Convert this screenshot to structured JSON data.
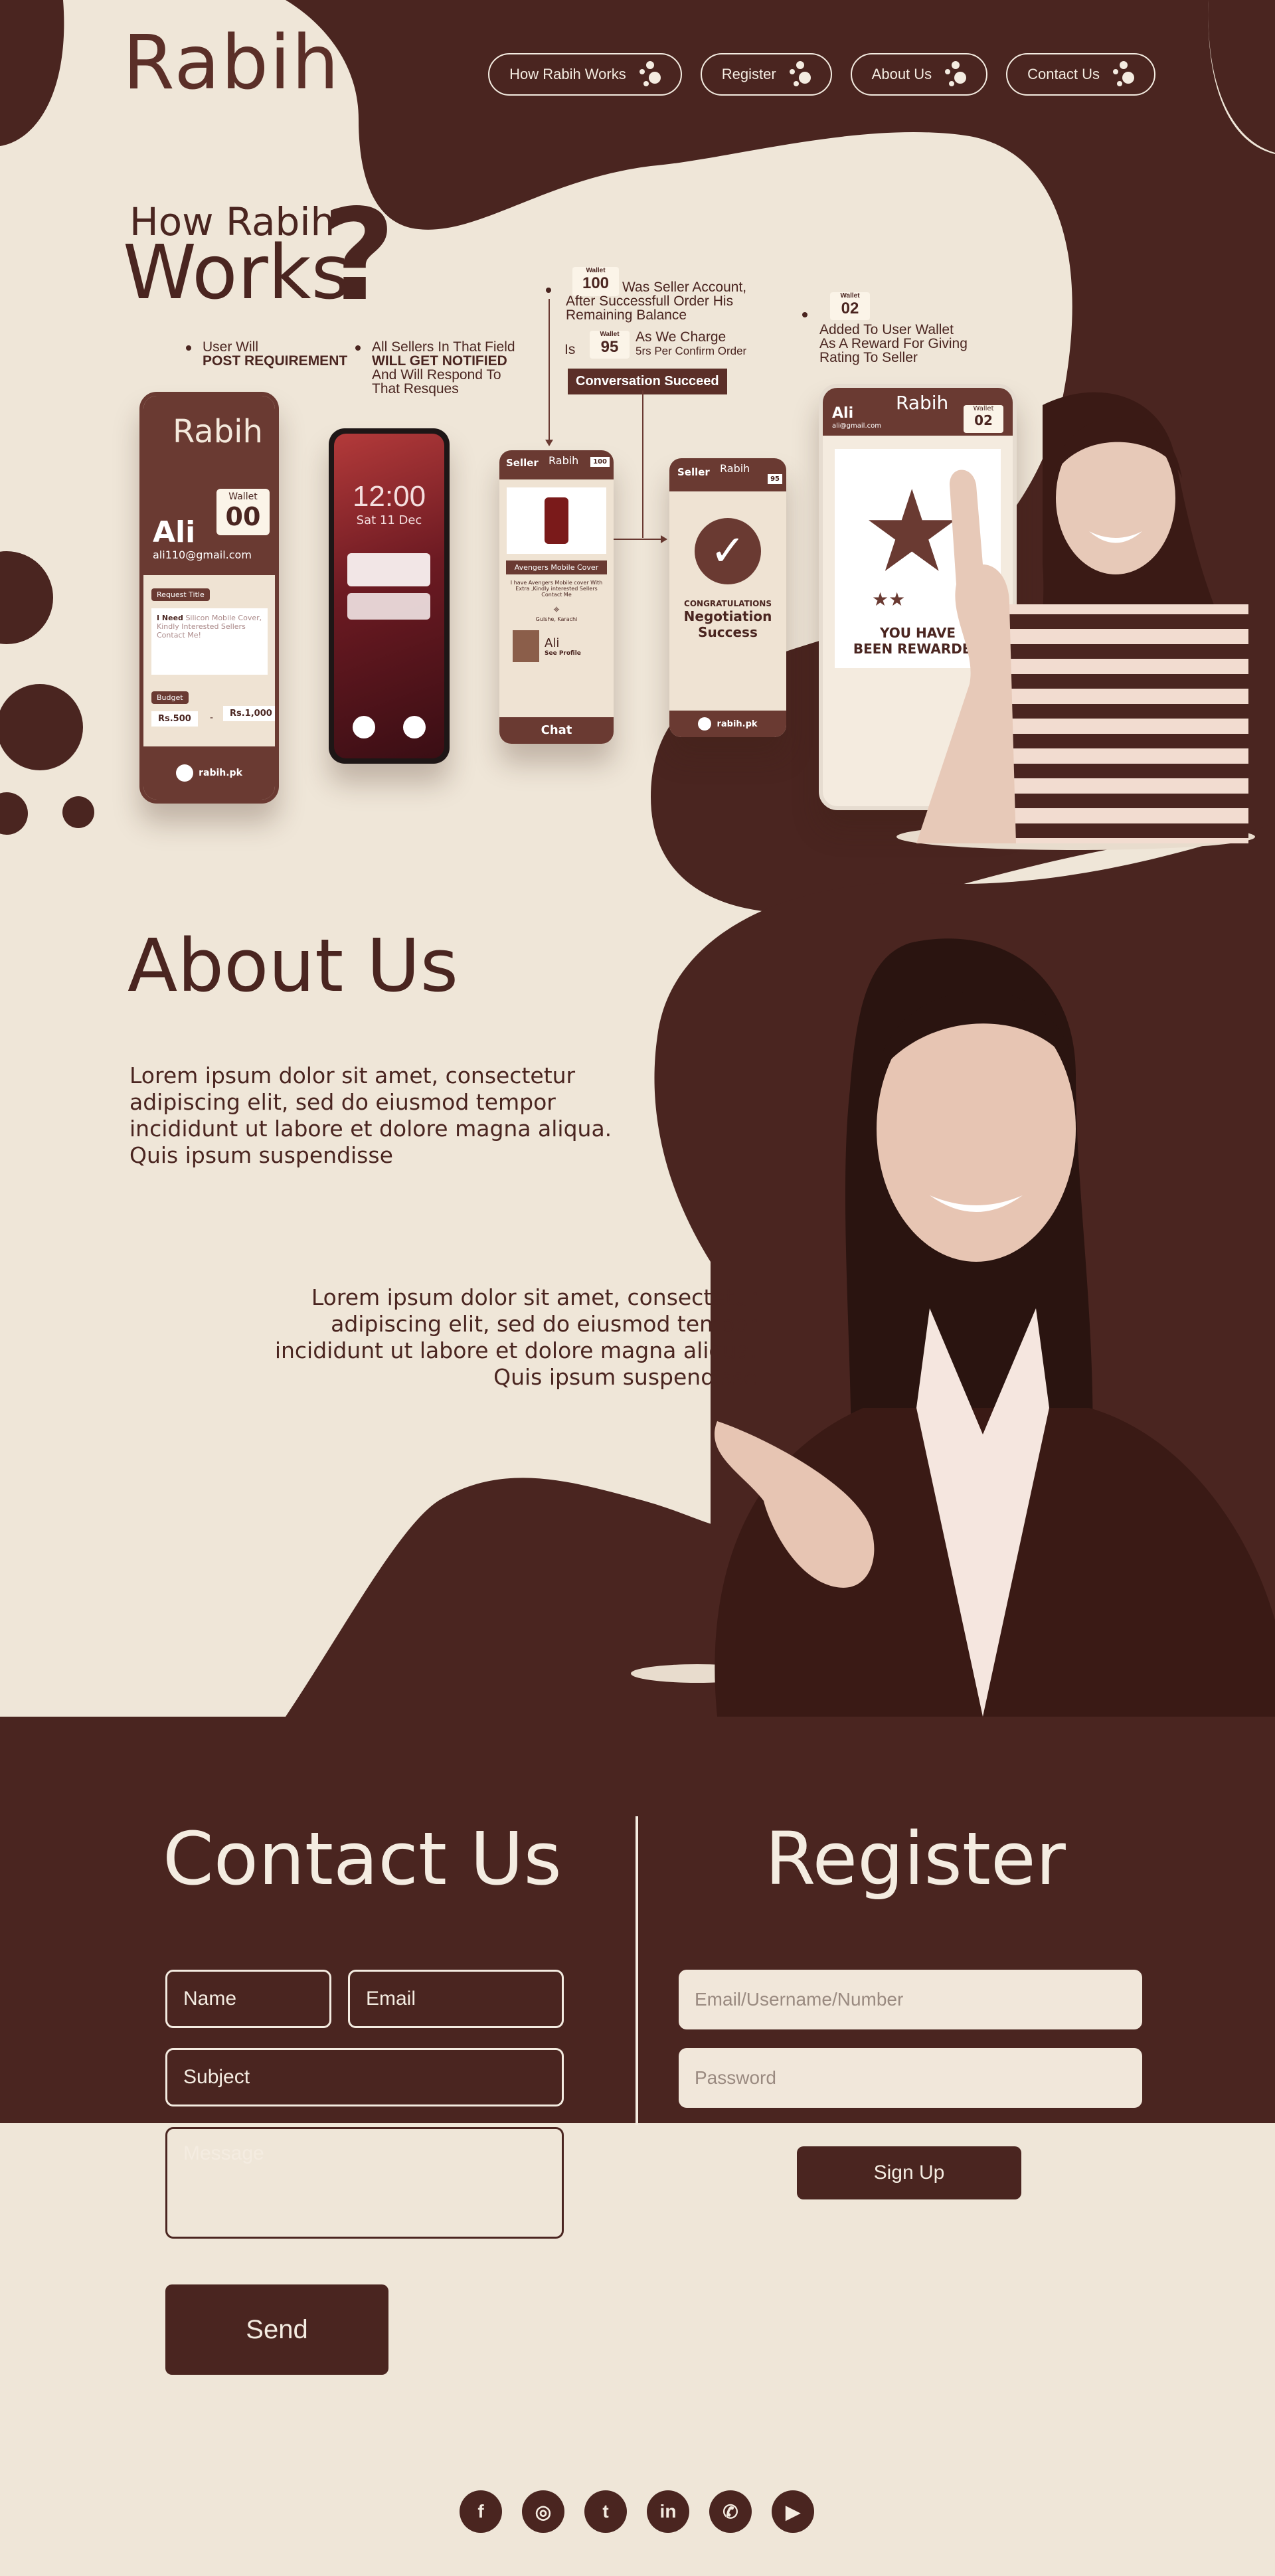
{
  "header": {
    "logo": "Rabih",
    "nav": [
      {
        "label": "How Rabih Works"
      },
      {
        "label": "Register"
      },
      {
        "label": "About Us"
      },
      {
        "label": "Contact Us"
      }
    ]
  },
  "how": {
    "title_small": "How Rabih",
    "title_big": "Works",
    "title_q": "?",
    "notes": {
      "post_line1": "User Will",
      "post_line2": "POST REQUIREMENT",
      "sellers_line1": "All Sellers In That Field",
      "sellers_line2": "WILL GET NOTIFIED",
      "sellers_line3": "And Will Respond To",
      "sellers_line4": "That Resques",
      "wallet_tag": "Wallet",
      "wallet_value": "100",
      "seller_acc_line1": "Was Seller Account,",
      "seller_acc_line2": "After Successfull Order His",
      "seller_acc_line3": "Remaining Balance",
      "is_label": "Is",
      "wallet_tag2": "Wallet",
      "wallet_value2": "95",
      "charge_line1": "As We  Charge",
      "charge_line2": "5rs Per Confirm Order",
      "conversation": "Conversation Succeed",
      "wallet_tag3": "Wallet",
      "wallet_value3": "02",
      "reward_line1": "Added To User Wallet",
      "reward_line2": "As A Reward For Giving",
      "reward_line3": "Rating To Seller"
    },
    "phone1": {
      "logo": "Rabih",
      "wallet_label": "Wallet",
      "wallet_value": "00",
      "name": "Ali",
      "email": "ali110@gmail.com",
      "request_title": "Request Title",
      "request_text_bold": "I Need",
      "request_text": "Silicon Mobile Cover, Kindly Interested Sellers Contact Me!",
      "budget": "Budget",
      "min": "Rs.500",
      "dash": "-",
      "max": "Rs.1,000",
      "footer": "rabih.pk"
    },
    "phone2": {
      "time": "12:00",
      "date": "Sat 11 Dec"
    },
    "phone3": {
      "seller": "Seller",
      "logo": "Rabih",
      "wallet": "100",
      "product": "Avengers Mobile Cover",
      "desc": "I have Avengers Mobile cover With Extra ,Kindly interested Sellers Contact Me",
      "location": "Gulshe, Karachi",
      "buyer": "Ali",
      "see_profile": "See Profile",
      "chat": "Chat"
    },
    "phone4": {
      "seller": "Seller",
      "logo": "Rabih",
      "wallet": "95",
      "congrats": "CONGRATULATIONS",
      "negotiation": "Negotiation",
      "success": "Success",
      "footer": "rabih.pk"
    },
    "phone5": {
      "logo": "Rabih",
      "name": "Ali",
      "email": "ali@gmail.com",
      "wallet_label": "Wallet",
      "wallet_value": "02",
      "reward_text_line1": "YOU HAVE",
      "reward_text_line2": "BEEN REWARDED"
    }
  },
  "about": {
    "title": "About Us",
    "p1": "Lorem ipsum dolor sit amet, consectetur adipiscing elit, sed do eiusmod tempor incididunt ut labore et dolore magna aliqua. Quis ipsum suspendisse",
    "p2": "Lorem ipsum dolor sit amet, consectetur adipiscing elit, sed do eiusmod tempor incididunt ut labore et dolore magna aliqua. Quis ipsum suspendisse"
  },
  "contact": {
    "title": "Contact Us",
    "name_placeholder": "Name",
    "email_placeholder": "Email",
    "subject_placeholder": "Subject",
    "message_placeholder": "Message",
    "send": "Send"
  },
  "register": {
    "title": "Register",
    "user_placeholder": "Email/Username/Number",
    "password_placeholder": "Password",
    "signup": "Sign Up"
  },
  "social": [
    {
      "icon": "facebook-icon",
      "glyph": "f"
    },
    {
      "icon": "instagram-icon",
      "glyph": "◎"
    },
    {
      "icon": "twitter-icon",
      "glyph": "t"
    },
    {
      "icon": "linkedin-icon",
      "glyph": "in"
    },
    {
      "icon": "whatsapp-icon",
      "glyph": "✆"
    },
    {
      "icon": "youtube-icon",
      "glyph": "▶"
    }
  ],
  "colors": {
    "brown": "#4a2520",
    "cream": "#efe6d8"
  }
}
